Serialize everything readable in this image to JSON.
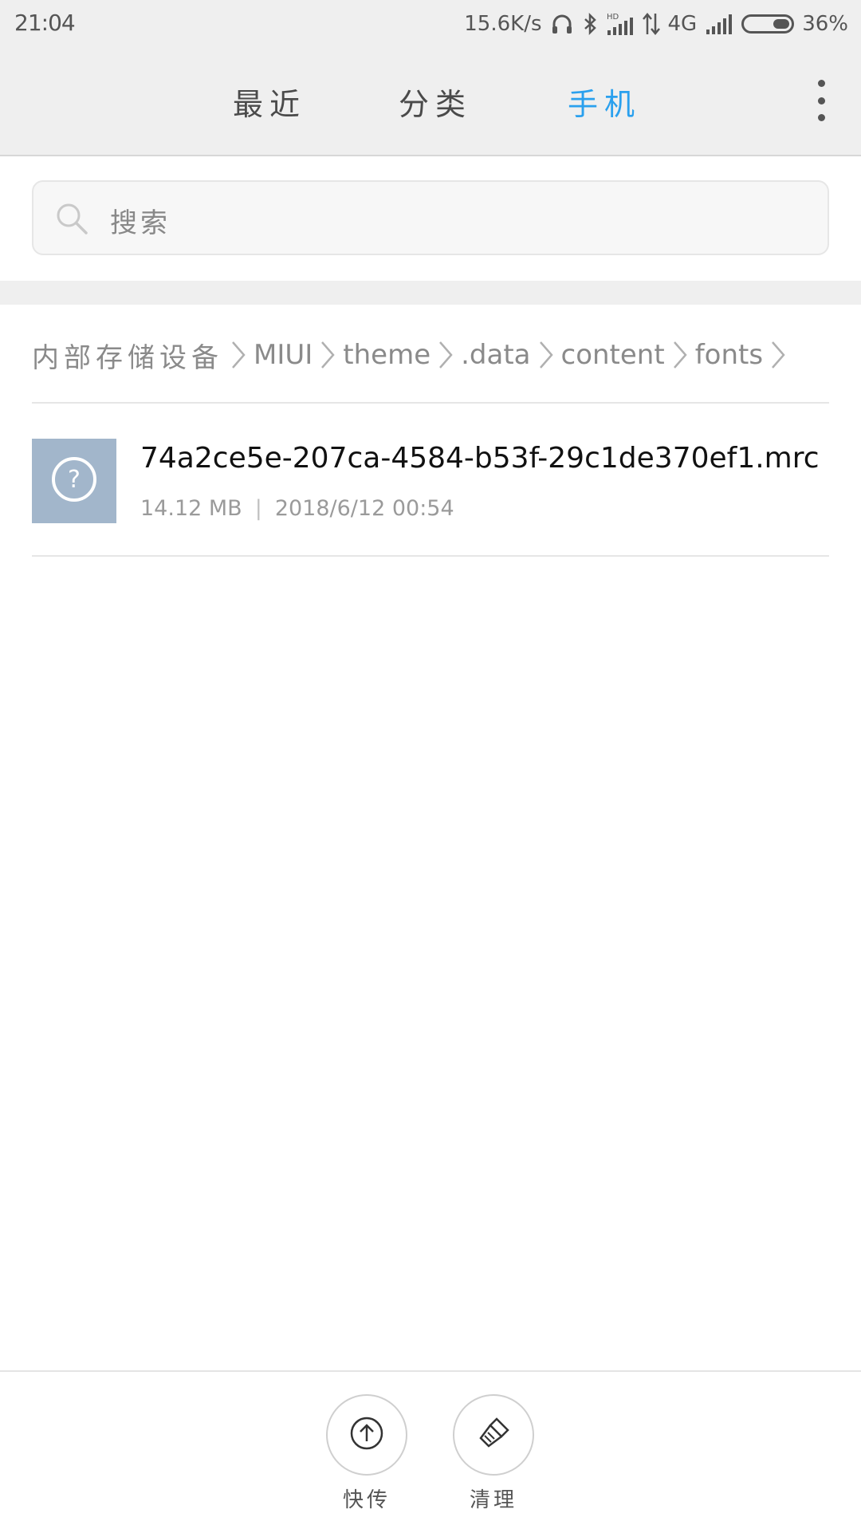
{
  "status_bar": {
    "time": "21:04",
    "net_speed": "15.6K/s",
    "hd_badge": "HD",
    "network_type": "4G",
    "battery": "36%",
    "battery_level": 0.36
  },
  "tabs": [
    {
      "label": "最近",
      "active": false
    },
    {
      "label": "分类",
      "active": false
    },
    {
      "label": "手机",
      "active": true
    }
  ],
  "search": {
    "placeholder": "搜索"
  },
  "breadcrumb": [
    "内部存储设备",
    "MIUI",
    "theme",
    ".data",
    "content",
    "fonts"
  ],
  "files": [
    {
      "name": "74a2ce5e-207ca-4584-b53f-29c1de370ef1.mrc",
      "size": "14.12 MB",
      "date": "2018/6/12 00:54",
      "icon": "unknown-file-icon"
    }
  ],
  "toolbar": {
    "share_label": "快传",
    "share_icon": "upload-icon",
    "clean_label": "清理",
    "clean_icon": "brush-icon"
  },
  "colors": {
    "accent": "#2aa0ee",
    "thumb": "#a2b6cb",
    "header_bg": "#efefef"
  }
}
